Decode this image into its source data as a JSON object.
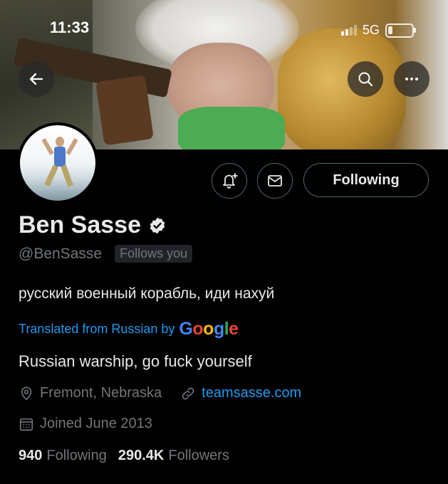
{
  "status_bar": {
    "time": "11:33",
    "network": "5G"
  },
  "header": {
    "back_icon": "arrow-left-icon",
    "search_icon": "search-icon",
    "more_icon": "more-icon"
  },
  "actions": {
    "following_label": "Following",
    "bell_icon": "bell-plus-icon",
    "mail_icon": "mail-icon"
  },
  "profile": {
    "name": "Ben Sasse",
    "handle": "@BenSasse",
    "follows_you": "Follows you",
    "bio": "русский военный корабль, иди нахуй",
    "translated_from": "Translated from Russian by",
    "google": {
      "G": "G",
      "o1": "o",
      "o2": "o",
      "g": "g",
      "l": "l",
      "e": "e"
    },
    "translation": "Russian warship, go fuck yourself",
    "location": "Fremont, Nebraska",
    "website": "teamsasse.com",
    "joined": "Joined June 2013",
    "following_count": "940",
    "following_label": "Following",
    "followers_count": "290.4K",
    "followers_label": "Followers"
  },
  "colors": {
    "accent": "#1d9bf0",
    "muted": "#71767b",
    "text": "#e7e9ea",
    "background": "#000000"
  }
}
